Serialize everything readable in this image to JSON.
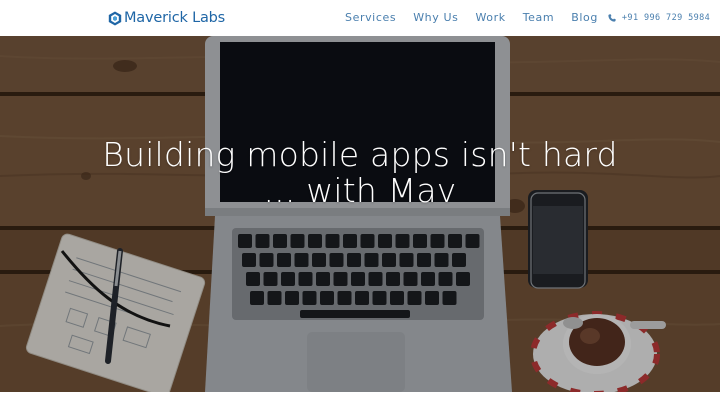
{
  "brand": {
    "name": "Maverick Labs"
  },
  "nav": {
    "items": [
      {
        "label": "Services"
      },
      {
        "label": "Why Us"
      },
      {
        "label": "Work"
      },
      {
        "label": "Team"
      },
      {
        "label": "Blog"
      }
    ],
    "phone": "+91 996 729 5984"
  },
  "hero": {
    "line1": "Building mobile apps isn't hard",
    "line2": "... with Mav"
  },
  "colors": {
    "brand_blue": "#1f66a6",
    "nav_text": "#4a7fae",
    "hero_text": "#ffffff"
  },
  "icons": {
    "logo": "hexagon-cube-icon",
    "phone": "phone-icon"
  }
}
